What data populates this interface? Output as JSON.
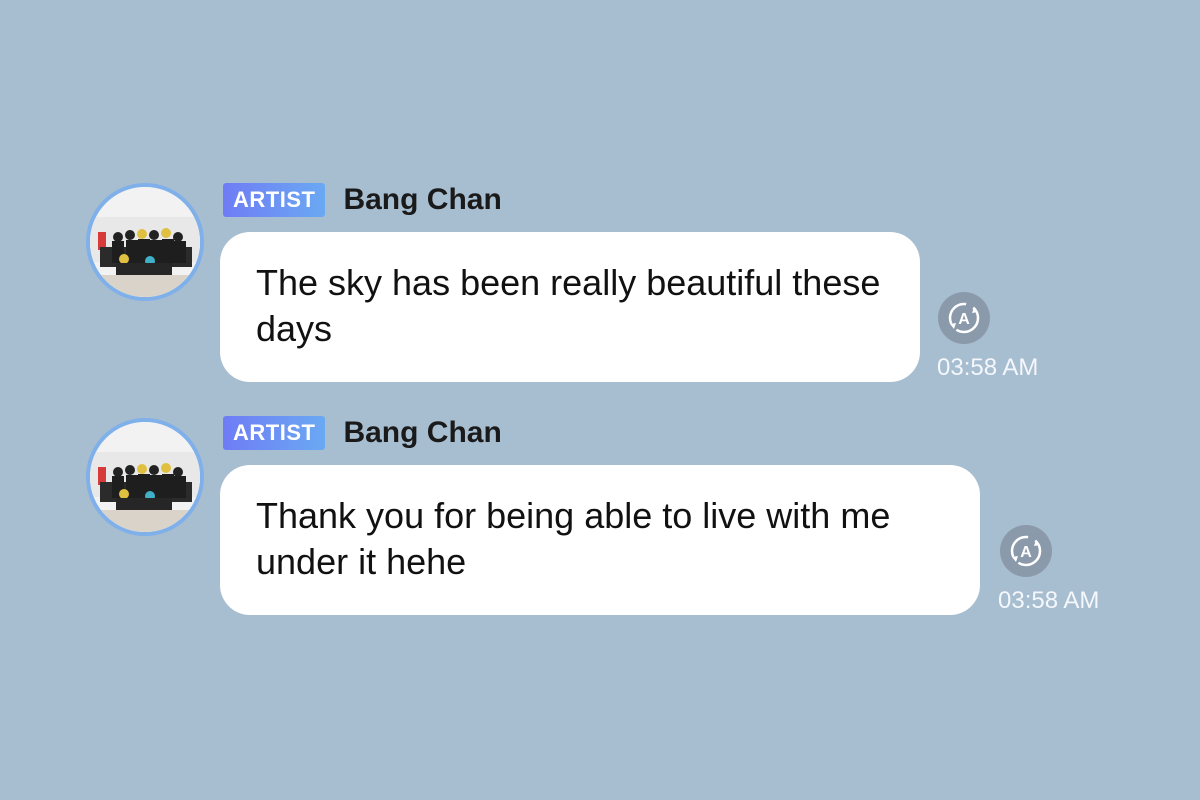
{
  "messages": [
    {
      "badge": "ARTIST",
      "sender": "Bang Chan",
      "text": "The sky has been really beautiful these days",
      "time": "03:58 AM",
      "translate_icon": "translate-icon"
    },
    {
      "badge": "ARTIST",
      "sender": "Bang Chan",
      "text": "Thank you for being able to live with me under it hehe",
      "time": "03:58 AM",
      "translate_icon": "translate-icon"
    }
  ],
  "colors": {
    "background": "#a7bdd0",
    "badge_start": "#6f7cf5",
    "badge_end": "#6aa9f3",
    "avatar_ring": "#7fb0ea",
    "bubble": "#ffffff"
  }
}
